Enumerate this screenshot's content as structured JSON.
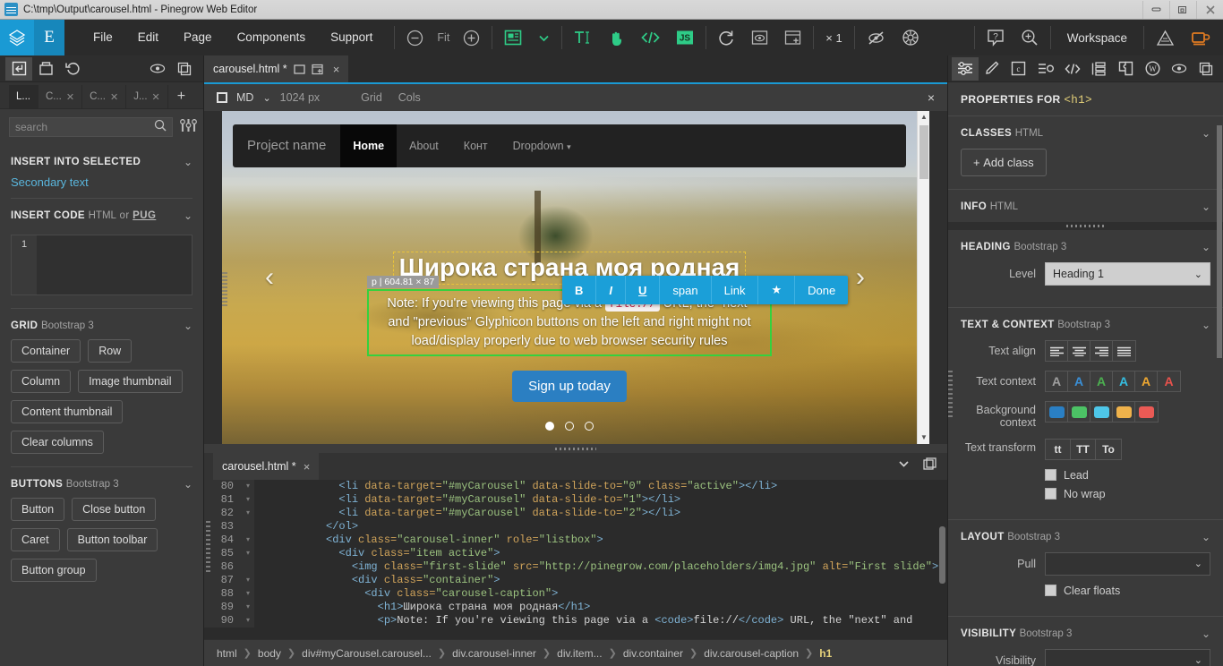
{
  "window": {
    "title": "C:\\tmp\\Output\\carousel.html - Pinegrow Web Editor",
    "minimize": "minimize-icon",
    "restore": "restore-icon",
    "close": "close-icon"
  },
  "menubar": {
    "logo": "pinegrow-logo",
    "editor_badge": "E",
    "items": [
      "File",
      "Edit",
      "Page",
      "Components",
      "Support"
    ],
    "zoom_out": "zoom-out-icon",
    "zoom_label": "Fit",
    "zoom_in": "zoom-in-icon",
    "page_view": "page-view-icon",
    "page_view_chevron": "chevron-down-icon",
    "text_tool": "text-edit-icon",
    "hand_tool": "hand-icon",
    "code_tool": "code-icon",
    "js_tool": "js-icon",
    "reload": "reload-icon",
    "preview": "preview-icon",
    "new_window": "open-in-window-icon",
    "multiplier": "× 1",
    "hide_markup": "eye-off-icon",
    "settings_gear": "gear-icon",
    "help": "help-icon",
    "find": "find-icon",
    "workspace": "Workspace",
    "activity": "activity-icon",
    "coffee": "coffee-icon"
  },
  "left_panel": {
    "tools": [
      "import-icon",
      "save-icon",
      "undo-icon",
      "eye-icon",
      "duplicate-icon"
    ],
    "library_tabs": [
      {
        "label": "L...",
        "active": true,
        "closable": false
      },
      {
        "label": "C...",
        "active": false,
        "closable": true
      },
      {
        "label": "C...",
        "active": false,
        "closable": true
      },
      {
        "label": "J...",
        "active": false,
        "closable": true
      }
    ],
    "add_tab": "+",
    "search": {
      "placeholder": "search",
      "value": "",
      "icon": "search-icon",
      "filter_icon": "filter-icon"
    },
    "sections": [
      {
        "title": "INSERT INTO SELECTED",
        "subtitle": "",
        "link": "Secondary text"
      },
      {
        "title": "INSERT CODE",
        "subtitle": "HTML",
        "or": "or",
        "pug": "PUG",
        "line_number": "1"
      },
      {
        "title": "GRID",
        "subtitle": "Bootstrap 3",
        "buttons": [
          "Container",
          "Row",
          "Column",
          "Image thumbnail",
          "Content thumbnail",
          "Clear columns"
        ]
      },
      {
        "title": "BUTTONS",
        "subtitle": "Bootstrap 3",
        "buttons": [
          "Button",
          "Close button",
          "Caret",
          "Button toolbar",
          "Button group"
        ]
      }
    ]
  },
  "center": {
    "page_tab": {
      "label": "carousel.html *",
      "icon1": "window-icon",
      "icon2": "detach-icon",
      "close": "×"
    },
    "device_bar": {
      "device": "MD",
      "chevron": "chevron-down-icon",
      "width": "1024 px",
      "grid": "Grid",
      "cols": "Cols",
      "close": "×"
    },
    "preview": {
      "navbar": {
        "brand": "Project name",
        "links": [
          {
            "label": "Home",
            "active": true
          },
          {
            "label": "About",
            "active": false
          },
          {
            "label": "Конт",
            "active": false
          },
          {
            "label": "Dropdown",
            "active": false,
            "caret": true
          }
        ]
      },
      "prev_arrow": "‹",
      "next_arrow": "›",
      "heading": "Широка страна моя родная",
      "selection_badge": "p | 604.81 × 87",
      "paragraph_before": "Note: If you're viewing this page via a ",
      "paragraph_code": "file://",
      "paragraph_after": " URL, the \"next\" and \"previous\" Glyphicon buttons on the left and right might not load/display properly due to web browser security rules",
      "cta": "Sign up today",
      "indicators": [
        true,
        false,
        false
      ]
    },
    "format_toolbar": [
      "B",
      "I",
      "U",
      "span",
      "Link",
      "★",
      "Done"
    ],
    "code_panel": {
      "tab": "carousel.html *",
      "tab_close": "×",
      "collapse_icon": "chevron-down-icon",
      "detach_icon": "detach-icon",
      "lines": [
        {
          "n": "80",
          "fold": true,
          "indent": 12,
          "parts": [
            {
              "t": "<li ",
              "c": "tag"
            },
            {
              "t": "data-target=",
              "c": "attr"
            },
            {
              "t": "\"#myCarousel\"",
              "c": "str"
            },
            {
              "t": " ",
              "c": "plain"
            },
            {
              "t": "data-slide-to=",
              "c": "attr"
            },
            {
              "t": "\"0\"",
              "c": "str"
            },
            {
              "t": " ",
              "c": "plain"
            },
            {
              "t": "class=",
              "c": "attr"
            },
            {
              "t": "\"active\"",
              "c": "str"
            },
            {
              "t": "></li>",
              "c": "tag"
            }
          ]
        },
        {
          "n": "81",
          "fold": true,
          "indent": 12,
          "parts": [
            {
              "t": "<li ",
              "c": "tag"
            },
            {
              "t": "data-target=",
              "c": "attr"
            },
            {
              "t": "\"#myCarousel\"",
              "c": "str"
            },
            {
              "t": " ",
              "c": "plain"
            },
            {
              "t": "data-slide-to=",
              "c": "attr"
            },
            {
              "t": "\"1\"",
              "c": "str"
            },
            {
              "t": "></li>",
              "c": "tag"
            }
          ]
        },
        {
          "n": "82",
          "fold": true,
          "indent": 12,
          "parts": [
            {
              "t": "<li ",
              "c": "tag"
            },
            {
              "t": "data-target=",
              "c": "attr"
            },
            {
              "t": "\"#myCarousel\"",
              "c": "str"
            },
            {
              "t": " ",
              "c": "plain"
            },
            {
              "t": "data-slide-to=",
              "c": "attr"
            },
            {
              "t": "\"2\"",
              "c": "str"
            },
            {
              "t": "></li>",
              "c": "tag"
            }
          ]
        },
        {
          "n": "83",
          "fold": false,
          "indent": 10,
          "parts": [
            {
              "t": "</ol>",
              "c": "tag"
            }
          ]
        },
        {
          "n": "84",
          "fold": true,
          "indent": 10,
          "parts": [
            {
              "t": "<div ",
              "c": "tag"
            },
            {
              "t": "class=",
              "c": "attr"
            },
            {
              "t": "\"carousel-inner\"",
              "c": "str"
            },
            {
              "t": " ",
              "c": "plain"
            },
            {
              "t": "role=",
              "c": "attr"
            },
            {
              "t": "\"listbox\"",
              "c": "str"
            },
            {
              "t": ">",
              "c": "tag"
            }
          ]
        },
        {
          "n": "85",
          "fold": true,
          "indent": 12,
          "parts": [
            {
              "t": "<div ",
              "c": "tag"
            },
            {
              "t": "class=",
              "c": "attr"
            },
            {
              "t": "\"item active\"",
              "c": "str"
            },
            {
              "t": ">",
              "c": "tag"
            }
          ]
        },
        {
          "n": "86",
          "fold": false,
          "indent": 14,
          "parts": [
            {
              "t": "<img ",
              "c": "tag"
            },
            {
              "t": "class=",
              "c": "attr"
            },
            {
              "t": "\"first-slide\"",
              "c": "str"
            },
            {
              "t": " ",
              "c": "plain"
            },
            {
              "t": "src=",
              "c": "attr"
            },
            {
              "t": "\"http://pinegrow.com/placeholders/img4.jpg\"",
              "c": "str"
            },
            {
              "t": " ",
              "c": "plain"
            },
            {
              "t": "alt=",
              "c": "attr"
            },
            {
              "t": "\"First slide\"",
              "c": "str"
            },
            {
              "t": ">",
              "c": "tag"
            }
          ]
        },
        {
          "n": "87",
          "fold": true,
          "indent": 14,
          "parts": [
            {
              "t": "<div ",
              "c": "tag"
            },
            {
              "t": "class=",
              "c": "attr"
            },
            {
              "t": "\"container\"",
              "c": "str"
            },
            {
              "t": ">",
              "c": "tag"
            }
          ]
        },
        {
          "n": "88",
          "fold": true,
          "indent": 16,
          "parts": [
            {
              "t": "<div ",
              "c": "tag"
            },
            {
              "t": "class=",
              "c": "attr"
            },
            {
              "t": "\"carousel-caption\"",
              "c": "str"
            },
            {
              "t": ">",
              "c": "tag"
            }
          ]
        },
        {
          "n": "89",
          "fold": true,
          "indent": 18,
          "parts": [
            {
              "t": "<h1>",
              "c": "tag"
            },
            {
              "t": "Широка страна моя родная",
              "c": "plain"
            },
            {
              "t": "</h1>",
              "c": "tag"
            }
          ]
        },
        {
          "n": "90",
          "fold": true,
          "indent": 18,
          "parts": [
            {
              "t": "<p>",
              "c": "tag"
            },
            {
              "t": "Note: If you're viewing this page via a ",
              "c": "plain"
            },
            {
              "t": "<code>",
              "c": "tag"
            },
            {
              "t": "file://",
              "c": "plain"
            },
            {
              "t": "</code>",
              "c": "tag"
            },
            {
              "t": " URL, the \"next\" and",
              "c": "plain"
            }
          ]
        }
      ]
    },
    "breadcrumb": [
      "html",
      "body",
      "div#myCarousel.carousel...",
      "div.carousel-inner",
      "div.item...",
      "div.container",
      "div.carousel-caption",
      "h1"
    ]
  },
  "right_panel": {
    "tools": [
      "properties-icon",
      "style-icon",
      "image-icon",
      "attributes-icon",
      "code-icon",
      "tree-icon",
      "plugin-icon",
      "wordpress-icon",
      "eye-icon",
      "duplicate-icon"
    ],
    "header_label": "PROPERTIES FOR",
    "header_target": "<h1>",
    "sections": [
      {
        "title": "CLASSES",
        "subtitle": "HTML",
        "add_class": "Add class"
      },
      {
        "title": "INFO",
        "subtitle": "HTML"
      },
      {
        "title": "HEADING",
        "subtitle": "Bootstrap 3",
        "level_label": "Level",
        "level_value": "Heading 1"
      },
      {
        "title": "TEXT & CONTEXT",
        "subtitle": "Bootstrap 3",
        "text_align_label": "Text align",
        "text_context_label": "Text context",
        "background_context_label": "Background context",
        "text_transform_label": "Text transform",
        "text_transform_options": [
          "tt",
          "TT",
          "To"
        ],
        "checkboxes": [
          "Lead",
          "No wrap"
        ]
      },
      {
        "title": "LAYOUT",
        "subtitle": "Bootstrap 3",
        "pull_label": "Pull",
        "pull_value": "",
        "checkboxes": [
          "Clear floats"
        ]
      },
      {
        "title": "VISIBILITY",
        "subtitle": "Bootstrap 3",
        "visibility_label": "Visibility"
      }
    ],
    "text_context_colors": [
      "#9e9e9e",
      "#3a8fd6",
      "#4caf50",
      "#35bde0",
      "#efa831",
      "#e8524c"
    ],
    "background_context_colors": [
      "#2a7fc4",
      "#4cc265",
      "#4ec6e8",
      "#efb24b",
      "#ea5a55"
    ]
  }
}
